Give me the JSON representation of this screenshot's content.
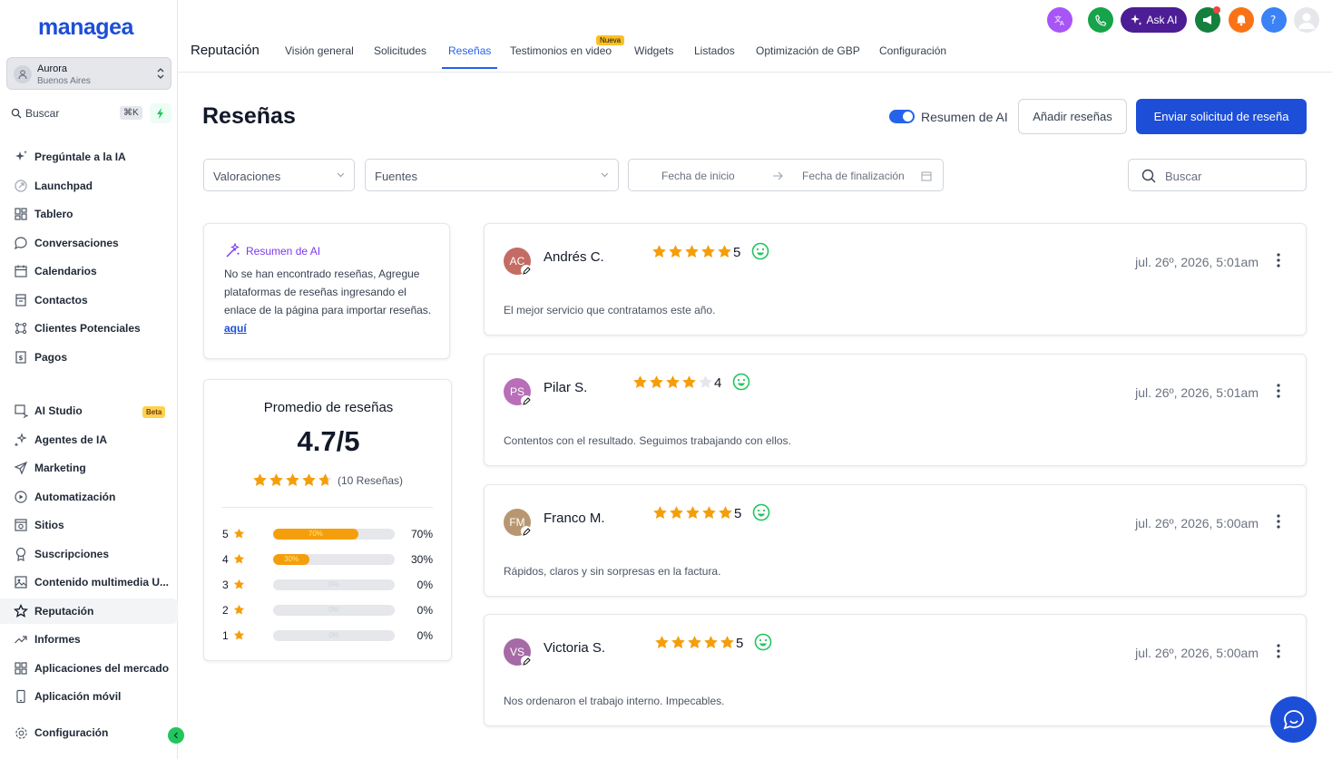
{
  "app": {
    "logo": "managea"
  },
  "location": {
    "name": "Aurora",
    "city": "Buenos Aires"
  },
  "sidebar": {
    "search_label": "Buscar",
    "search_shortcut": "⌘K",
    "items": [
      {
        "label": "Pregúntale a la IA",
        "icon": "sparkles-icon"
      },
      {
        "label": "Launchpad",
        "icon": "rocket-icon"
      },
      {
        "label": "Tablero",
        "icon": "dashboard-icon"
      },
      {
        "label": "Conversaciones",
        "icon": "chat-icon"
      },
      {
        "label": "Calendarios",
        "icon": "calendar-icon"
      },
      {
        "label": "Contactos",
        "icon": "contacts-icon"
      },
      {
        "label": "Clientes Potenciales",
        "icon": "pipeline-icon"
      },
      {
        "label": "Pagos",
        "icon": "payments-icon"
      },
      {
        "label": "AI Studio",
        "icon": "ai-studio-icon",
        "badge": "Beta"
      },
      {
        "label": "Agentes de IA",
        "icon": "ai-agents-icon"
      },
      {
        "label": "Marketing",
        "icon": "send-icon"
      },
      {
        "label": "Automatización",
        "icon": "automation-icon"
      },
      {
        "label": "Sitios",
        "icon": "sites-icon"
      },
      {
        "label": "Suscripciones",
        "icon": "badge-icon"
      },
      {
        "label": "Contenido multimedia U...",
        "icon": "image-icon"
      },
      {
        "label": "Reputación",
        "icon": "star-icon"
      },
      {
        "label": "Informes",
        "icon": "trend-icon"
      },
      {
        "label": "Aplicaciones del mercado",
        "icon": "apps-icon"
      },
      {
        "label": "Aplicación móvil",
        "icon": "mobile-icon"
      }
    ],
    "settings_label": "Configuración"
  },
  "topnav": {
    "section": "Reputación",
    "tabs": [
      "Visión general",
      "Solicitudes",
      "Reseñas",
      "Testimonios en video",
      "Widgets",
      "Listados",
      "Optimización de GBP",
      "Configuración"
    ],
    "active_tab": "Reseñas",
    "new_badge": "Nueva",
    "ask_ai": "Ask AI"
  },
  "page": {
    "title": "Reseñas",
    "ai_toggle_label": "Resumen de AI",
    "add_reviews": "Añadir reseñas",
    "send_request": "Enviar solicitud de reseña"
  },
  "filters": {
    "ratings": "Valoraciones",
    "sources": "Fuentes",
    "start_date": "Fecha de inicio",
    "end_date": "Fecha de finalización",
    "search_placeholder": "Buscar"
  },
  "ai_summary": {
    "title": "Resumen de AI",
    "body": "No se han encontrado reseñas, Agregue plataformas de reseñas ingresando el enlace de la página para importar reseñas.",
    "link": "aquí"
  },
  "average": {
    "title": "Promedio de reseñas",
    "value": "4.7/5",
    "rating": 4.7,
    "count_text": "(10 Reseñas)",
    "distribution": [
      {
        "stars": "5",
        "percent": 70,
        "pct_label": "70%"
      },
      {
        "stars": "4",
        "percent": 30,
        "pct_label": "30%"
      },
      {
        "stars": "3",
        "percent": 0,
        "pct_label": "0%"
      },
      {
        "stars": "2",
        "percent": 0,
        "pct_label": "0%"
      },
      {
        "stars": "1",
        "percent": 0,
        "pct_label": "0%"
      }
    ]
  },
  "reviews": [
    {
      "initials": "AC",
      "name": "Andrés C.",
      "rating": 5,
      "date": "jul. 26º, 2026, 5:01am",
      "text": "El mejor servicio que contratamos este año.",
      "color": "#c46b64"
    },
    {
      "initials": "PS",
      "name": "Pilar S.",
      "rating": 4,
      "date": "jul. 26º, 2026, 5:01am",
      "text": "Contentos con el resultado. Seguimos trabajando con ellos.",
      "color": "#b86fb8"
    },
    {
      "initials": "FM",
      "name": "Franco M.",
      "rating": 5,
      "date": "jul. 26º, 2026, 5:00am",
      "text": "Rápidos, claros y sin sorpresas en la factura.",
      "color": "#b89770"
    },
    {
      "initials": "VS",
      "name": "Victoria S.",
      "rating": 5,
      "date": "jul. 26º, 2026, 5:00am",
      "text": "Nos ordenaron el trabajo interno. Impecables.",
      "color": "#a66ba6"
    }
  ],
  "colors": {
    "primary": "#1d4ed8",
    "star": "#f59e0b",
    "ai_purple": "#7c3aed",
    "smile": "#22c55e"
  }
}
